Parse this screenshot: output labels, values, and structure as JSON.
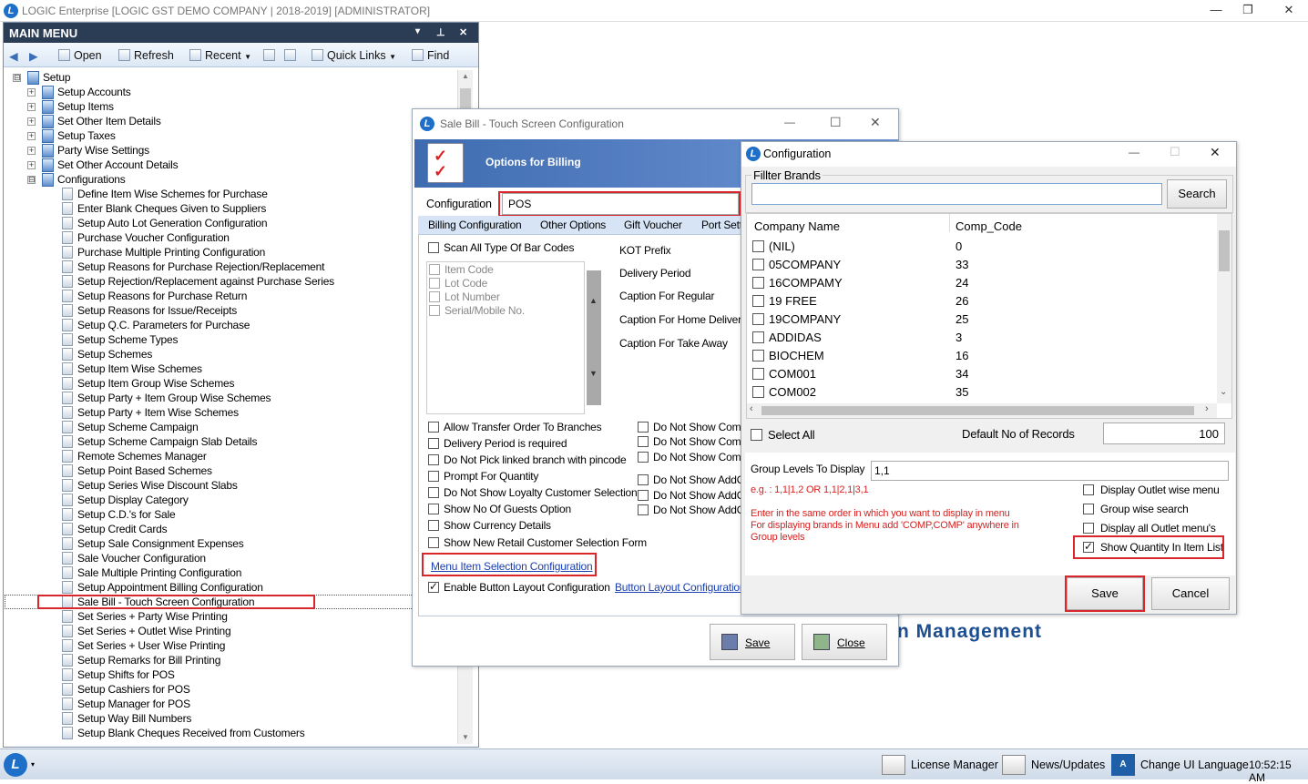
{
  "app": {
    "title": "LOGIC Enterprise [LOGIC GST DEMO COMPANY | 2018-2019] [ADMINISTRATOR]"
  },
  "main_menu": {
    "title": "MAIN MENU",
    "toolbar": {
      "open": "Open",
      "refresh": "Refresh",
      "recent": "Recent",
      "quick_links": "Quick Links",
      "find": "Find"
    }
  },
  "tree": {
    "root": "Setup",
    "groups": [
      "Setup Accounts",
      "Setup Items",
      "Set Other Item Details",
      "Setup Taxes",
      "Party Wise Settings",
      "Set Other Account Details"
    ],
    "configurations": "Configurations",
    "items": [
      "Define Item Wise Schemes for Purchase",
      "Enter Blank Cheques Given to Suppliers",
      "Setup Auto Lot Generation Configuration",
      "Purchase Voucher Configuration",
      "Purchase Multiple Printing Configuration",
      "Setup Reasons for Purchase Rejection/Replacement",
      "Setup Rejection/Replacement against Purchase Series",
      "Setup Reasons for Purchase Return",
      "Setup Reasons for Issue/Receipts",
      "Setup Q.C. Parameters for Purchase",
      "Setup Scheme Types",
      "Setup Schemes",
      "Setup Item Wise Schemes",
      "Setup Item Group Wise Schemes",
      "Setup Party + Item Group Wise Schemes",
      "Setup Party + Item Wise Schemes",
      "Setup Scheme Campaign",
      "Setup Scheme Campaign Slab Details",
      "Remote Schemes Manager",
      "Setup Point Based Schemes",
      "Setup Series Wise Discount Slabs",
      "Setup Display Category",
      "Setup C.D.'s for Sale",
      "Setup Credit Cards",
      "Setup Sale Consignment Expenses",
      "Sale Voucher Configuration",
      "Sale Multiple Printing Configuration",
      "Setup Appointment Billing Configuration",
      "Sale Bill - Touch Screen Configuration",
      "Set Series + Party Wise Printing",
      "Set Series + Outlet Wise Printing",
      "Set Series + User Wise Printing",
      "Setup Remarks for Bill Printing",
      "Setup Shifts for POS",
      "Setup Cashiers for POS",
      "Setup Manager for POS",
      "Setup Way Bill Numbers",
      "Setup Blank Cheques Received from Customers"
    ]
  },
  "sale_dialog": {
    "title": "Sale Bill - Touch Screen Configuration",
    "header": "Options for Billing",
    "config_label": "Configuration",
    "config_value": "POS",
    "tabs": [
      "Billing Configuration",
      "Other Options",
      "Gift Voucher",
      "Port Setti"
    ],
    "scan_label": "Scan All Type Of Bar Codes",
    "list": [
      "Item Code",
      "Lot Code",
      "Lot Number",
      "Serial/Mobile No."
    ],
    "right_labels": [
      "KOT Prefix",
      "Delivery Period",
      "Caption For Regular",
      "Caption For Home Delivery",
      "Caption For Take Away"
    ],
    "left_checks": [
      "Allow Transfer Order To Branches",
      "Delivery Period is required",
      "Do Not Pick linked branch with pincode",
      "Prompt For Quantity",
      "Do Not Show Loyalty Customer Selection",
      "Show No Of Guests Option",
      "Show Currency Details",
      "Show New Retail Customer Selection Form"
    ],
    "right_checks": [
      "Do Not Show Combo",
      "Do Not Show Combo",
      "Do Not Show Combo",
      "Do Not Show AddOn",
      "Do Not Show AddOn",
      "Do Not Show AddOn"
    ],
    "menu_link": "Menu Item Selection Configuration",
    "enable_layout": "Enable Button Layout Configuration",
    "layout_link": "Button Layout Configuration",
    "save": "Save",
    "close": "Close"
  },
  "config_dialog": {
    "title": "Configuration",
    "filter_label": "Fillter Brands",
    "search": "Search",
    "col1": "Company Name",
    "col2": "Comp_Code",
    "rows": [
      [
        "(NIL)",
        "0"
      ],
      [
        "05COMPANY",
        "33"
      ],
      [
        "16COMPAMY",
        "24"
      ],
      [
        "19 FREE",
        "26"
      ],
      [
        "19COMPANY",
        "25"
      ],
      [
        "ADDIDAS",
        "3"
      ],
      [
        "BIOCHEM",
        "16"
      ],
      [
        "COM001",
        "34"
      ],
      [
        "COM002",
        "35"
      ]
    ],
    "select_all": "Select All",
    "default_records_label": "Default No of Records",
    "default_records": "100",
    "group_levels_label": "Group Levels To Display",
    "group_levels": "1,1",
    "eg": "e.g. :  1,1|1,2   OR  1,1|2,1|3,1",
    "note1": "Enter in the same order in which you want to display in menu",
    "note2": "For displaying brands in Menu add 'COMP,COMP' anywhere in",
    "note3": "Group levels",
    "opts": [
      "Display Outlet wise menu",
      "Group wise search",
      "Display all Outlet menu's",
      "Show Quantity In Item List"
    ],
    "save": "Save",
    "cancel": "Cancel"
  },
  "background_text": "n Management",
  "status": {
    "license": "License Manager",
    "news": "News/Updates",
    "lang": "Change UI Language",
    "time": "10:52:15 AM"
  }
}
